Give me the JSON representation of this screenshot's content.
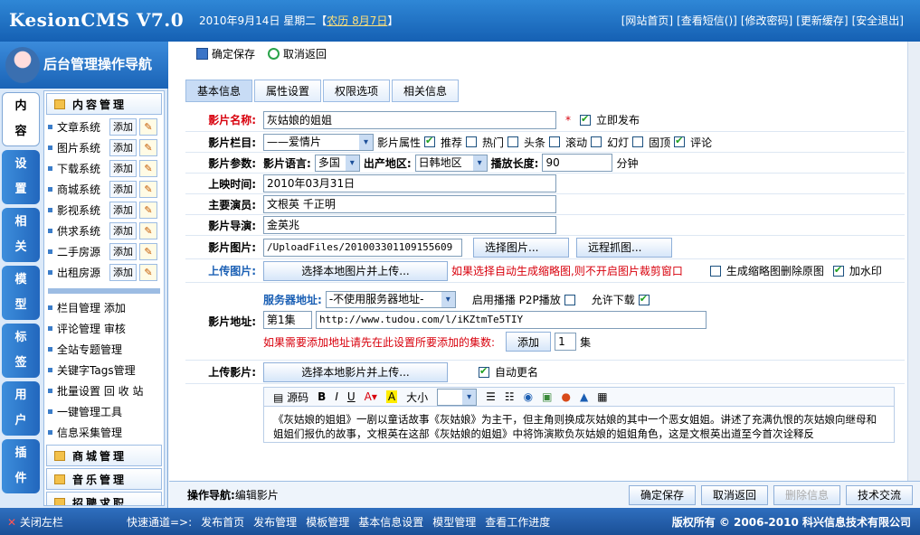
{
  "app": {
    "logo": "KesionCMS V7.0",
    "date": "2010年9月14日 星期二【",
    "lunar": "农历 8月7日",
    "date_end": "】"
  },
  "top_links": [
    "[网站首页]",
    "[查看短信(",
    ")]",
    "[修改密码]",
    "[更新缓存]",
    "[安全退出]"
  ],
  "top_links_badge": "",
  "nav_header": "后台管理操作导航",
  "vtabs": [
    [
      "内",
      "容"
    ],
    [
      "设",
      "置"
    ],
    [
      "相",
      "关"
    ],
    [
      "模",
      "型"
    ],
    [
      "标",
      "签"
    ],
    [
      "用",
      "户"
    ],
    [
      "插",
      "件"
    ]
  ],
  "menu": {
    "head": "内容管理",
    "items": [
      {
        "name": "文章系统",
        "add": "添加"
      },
      {
        "name": "图片系统",
        "add": "添加"
      },
      {
        "name": "下载系统",
        "add": "添加"
      },
      {
        "name": "商城系统",
        "add": "添加"
      },
      {
        "name": "影视系统",
        "add": "添加"
      },
      {
        "name": "供求系统",
        "add": "添加"
      },
      {
        "name": "二手房源",
        "add": "添加"
      },
      {
        "name": "出租房源",
        "add": "添加"
      }
    ],
    "links": [
      "栏目管理  添加",
      "评论管理  审核",
      "全站专题管理",
      "关键字Tags管理",
      "批量设置  回 收 站",
      "一键管理工具",
      "信息采集管理"
    ],
    "heads2": [
      "商城管理",
      "音乐管理",
      "招聘求职"
    ]
  },
  "toolbar": {
    "save": "确定保存",
    "back": "取消返回"
  },
  "tabs": [
    "基本信息",
    "属性设置",
    "权限选项",
    "相关信息"
  ],
  "form": {
    "title_label": "影片名称:",
    "title_value": "灰姑娘的姐姐",
    "publish": "立即发布",
    "cat_label": "影片栏目:",
    "cat_value": "——爱情片",
    "attr_label": "影片属性",
    "attrs": [
      {
        "t": "推荐",
        "on": true
      },
      {
        "t": "热门",
        "on": false
      },
      {
        "t": "头条",
        "on": false
      },
      {
        "t": "滚动",
        "on": false
      },
      {
        "t": "幻灯",
        "on": false
      },
      {
        "t": "固顶",
        "on": false
      },
      {
        "t": "评论",
        "on": true
      }
    ],
    "param_label": "影片参数:",
    "lang_label": "影片语言:",
    "lang_value": "多国",
    "region_label": "出产地区:",
    "region_value": "日韩地区",
    "len_label": "播放长度:",
    "len_value": "90",
    "len_unit": "分钟",
    "date_label": "上映时间:",
    "date_value": "2010年03月31日",
    "actor_label": "主要演员:",
    "actor_value": "文根英 千正明",
    "director_label": "影片导演:",
    "director_value": "金英兆",
    "pic_label": "影片图片:",
    "pic_value": "/UploadFiles/201003301109155609",
    "pic_btn": "选择图片...",
    "remote_btn": "远程抓图...",
    "upload_label": "上传图片:",
    "upload_btn": "选择本地图片并上传...",
    "upload_note": "如果选择自动生成缩略图,则不开启图片裁剪窗口",
    "thumb": "生成缩略图删除原图",
    "watermark": "加水印",
    "server_label": "服务器地址:",
    "server_value": "-不使用服务器地址-",
    "p2p": "启用播播 P2P播放",
    "allow_dl": "允许下载",
    "url_label": "影片地址:",
    "episode": "第1集",
    "url_value": "http://www.tudou.com/l/iKZtmTe5TIY",
    "add_note": "如果需要添加地址请先在此设置所要添加的集数:",
    "add_btn": "添加",
    "add_count": "1",
    "add_unit": "集",
    "upload_video_label": "上传影片:",
    "upload_video_btn": "选择本地影片并上传...",
    "auto_rename": "自动更名",
    "editor_src": "源码",
    "editor_size": "大小",
    "editor_text": "《灰姑娘的姐姐》一剧以童话故事《灰姑娘》为主干，但主角则换成灰姑娘的其中一个恶女姐姐。讲述了充满仇恨的灰姑娘向继母和姐姐们报仇的故事，文根英在这部《灰姑娘的姐姐》中将饰演欺负灰姑娘的姐姐角色，这是文根英出道至今首次诠释反"
  },
  "status": {
    "nav_label": "操作导航:",
    "nav_value": "编辑影片",
    "btns": [
      "确定保存",
      "取消返回",
      "删除信息",
      "技术交流"
    ]
  },
  "footer": {
    "close": "关闭左栏",
    "quick_label": "快速通道=>:",
    "quick": [
      "发布首页",
      "发布管理",
      "模板管理",
      "基本信息设置",
      "模型管理",
      "查看工作进度"
    ],
    "copy": "版权所有 © 2006-2010 科兴信息技术有限公司"
  }
}
